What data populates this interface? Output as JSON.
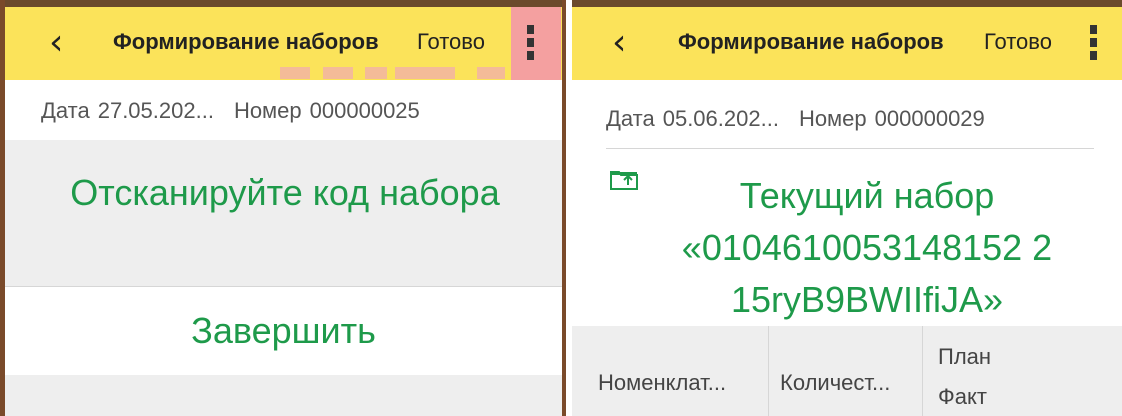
{
  "left_screen": {
    "header": {
      "back_icon": "‹",
      "title": "Формирование наборов",
      "done_label": "Готово",
      "menu_icon": "vertical-dots"
    },
    "meta": {
      "date_label": "Дата",
      "date_value": "27.05.202...",
      "number_label": "Номер",
      "number_value": "000000025"
    },
    "prompt": "Отсканируйте код набора",
    "finish_label": "Завершить"
  },
  "right_screen": {
    "header": {
      "back_icon": "‹",
      "title": "Формирование наборов",
      "done_label": "Готово",
      "menu_icon": "vertical-dots"
    },
    "meta": {
      "date_label": "Дата",
      "date_value": "05.06.202...",
      "number_label": "Номер",
      "number_value": "000000029"
    },
    "current_set": {
      "icon": "folder-upload-icon",
      "line1": "Текущий набор",
      "line2": "«0104610053148152 2",
      "line3": "15ryB9BWIIfiJA»"
    },
    "table": {
      "columns": [
        "Номенклат...",
        "Количест..."
      ],
      "plan_label": "План",
      "fact_label": "Факт"
    }
  },
  "colors": {
    "appbar": "#fbe35a",
    "accent_green": "#1e9a4a",
    "gray": "#eeeeee"
  }
}
